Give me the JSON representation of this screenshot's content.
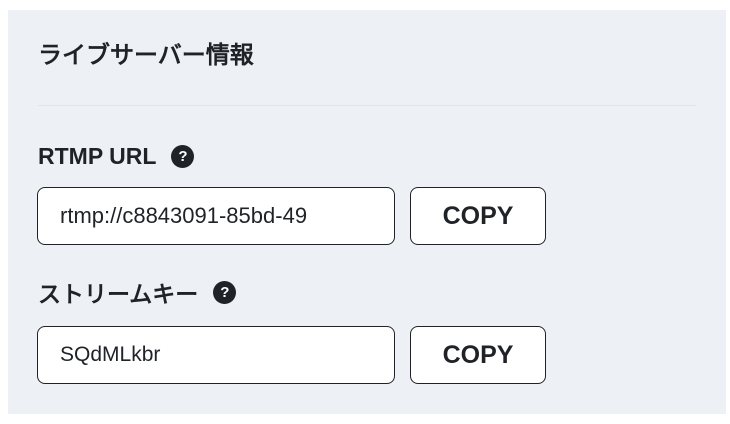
{
  "panel": {
    "title": "ライブサーバー情報"
  },
  "rtmp": {
    "label": "RTMP URL",
    "help_icon": "question-circle-icon",
    "help_glyph": "?",
    "value": "rtmp://c8843091-85bd-49",
    "copy_label": "COPY"
  },
  "stream_key": {
    "label": "ストリームキー",
    "help_icon": "question-circle-icon",
    "help_glyph": "?",
    "value": "SQdMLkbr",
    "copy_label": "COPY"
  },
  "colors": {
    "panel_background": "#edf1f6",
    "text": "#1f2227",
    "input_background": "#ffffff"
  }
}
